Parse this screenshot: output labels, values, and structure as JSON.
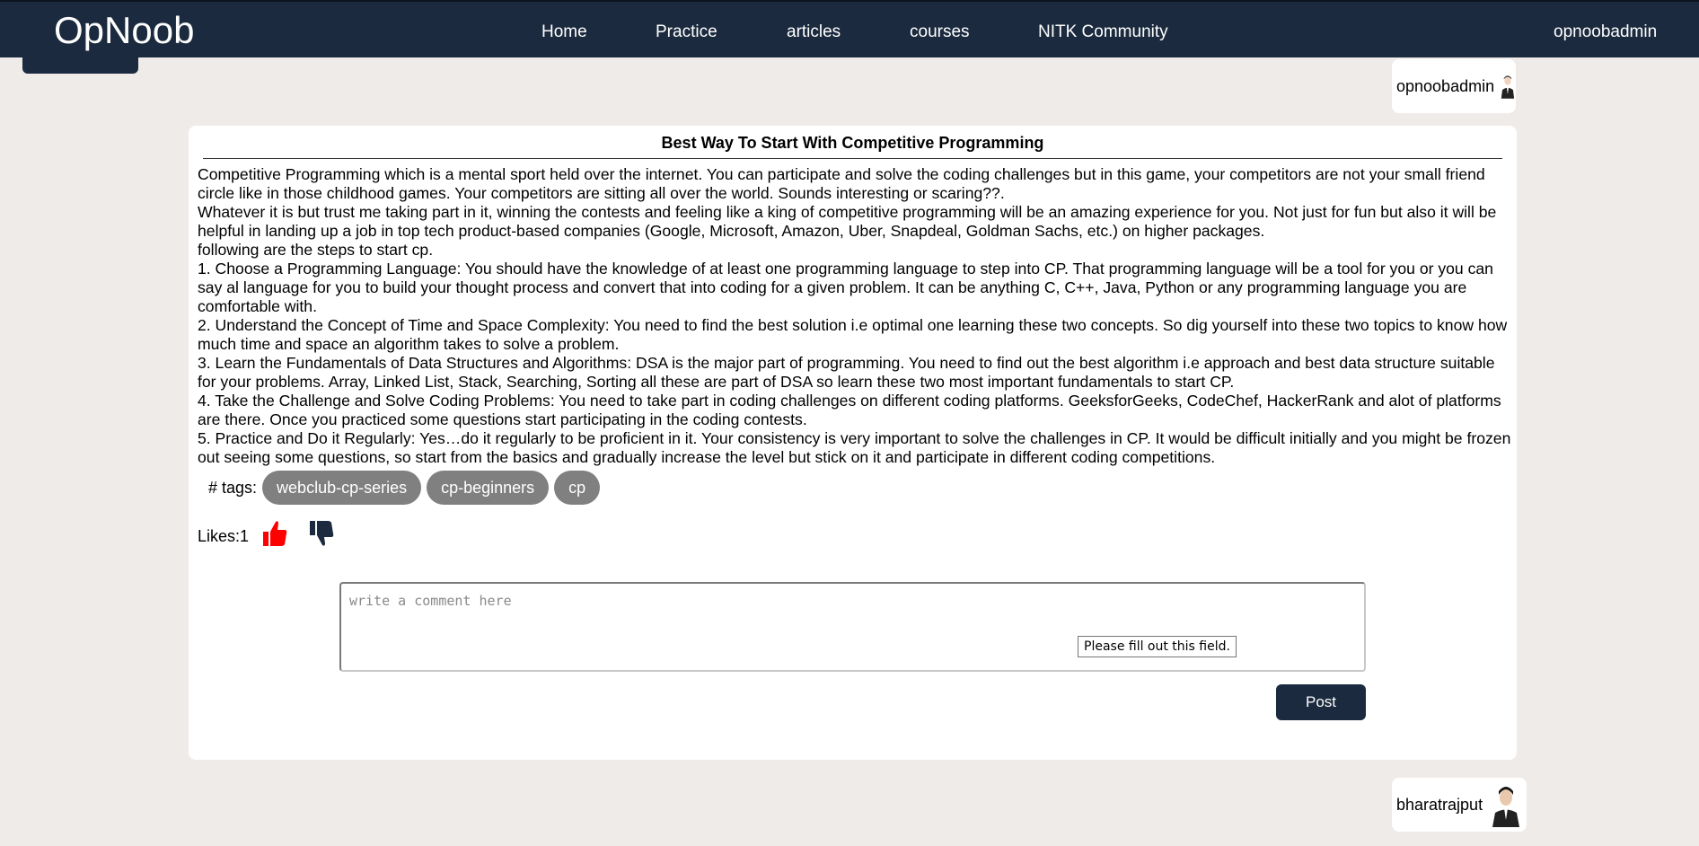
{
  "header": {
    "brand": "OpNoob",
    "nav": [
      {
        "label": "Home"
      },
      {
        "label": "Practice"
      },
      {
        "label": "articles"
      },
      {
        "label": "courses"
      },
      {
        "label": "NITK Community"
      }
    ],
    "username": "opnoobadmin"
  },
  "author": {
    "username": "opnoobadmin"
  },
  "post": {
    "title": "Best Way To Start With Competitive Programming",
    "paragraphs": [
      "Competitive Programming which is a mental sport held over the internet. You can participate and solve the coding challenges but in this game, your competitors are not your small friend circle like in those childhood games. Your competitors are sitting all over the world. Sounds interesting or scaring??.",
      "Whatever it is but trust me taking part in it, winning the contests and feeling like a king of competitive programming will be an amazing experience for you. Not just for fun but also it will be helpful in landing up a job in top tech product-based companies (Google, Microsoft, Amazon, Uber, Snapdeal, Goldman Sachs, etc.) on higher packages.",
      "following are the steps to start cp.",
      "1. Choose a Programming Language: You should have the knowledge of at least one programming language to step into CP. That programming language will be a tool for you or you can say al language for you to build your thought process and convert that into coding for a given problem. It can be anything C, C++, Java, Python or any programming language you are comfortable with.",
      "2. Understand the Concept of Time and Space Complexity: You need to find the best solution i.e optimal one learning these two concepts. So dig yourself into these two topics to know how much time and space an algorithm takes to solve a problem.",
      "3. Learn the Fundamentals of Data Structures and Algorithms: DSA is the major part of programming. You need to find out the best algorithm i.e approach and best data structure suitable for your problems. Array, Linked List, Stack, Searching, Sorting all these are part of DSA so learn these two most important fundamentals to start CP.",
      "4. Take the Challenge and Solve Coding Problems: You need to take part in coding challenges on different coding platforms. GeeksforGeeks, CodeChef, HackerRank and alot of platforms are there. Once you practiced some questions start participating in the coding contests.",
      "5. Practice and Do it Regularly: Yes…do it regularly to be proficient in it. Your consistency is very important to solve the challenges in CP. It would be difficult initially and you might be frozen out seeing some questions, so start from the basics and gradually increase the level but stick on it and participate in different coding competitions."
    ],
    "tags_label": "# tags:",
    "tags": [
      "webclub-cp-series",
      "cp-beginners",
      "cp"
    ],
    "likes_text": "Likes:1",
    "like_icon": "thumbs-up-icon",
    "dislike_icon": "thumbs-down-icon",
    "like_color": "#ff0000",
    "dislike_color": "#1b2a3e"
  },
  "comment": {
    "placeholder": "write a comment here",
    "validation_message": "Please fill out this field.",
    "post_label": "Post"
  },
  "commenter": {
    "username": "bharatrajput"
  },
  "colors": {
    "header_bg": "#1b2a3e",
    "page_bg": "#efebe9",
    "tag_bg": "#808080"
  }
}
